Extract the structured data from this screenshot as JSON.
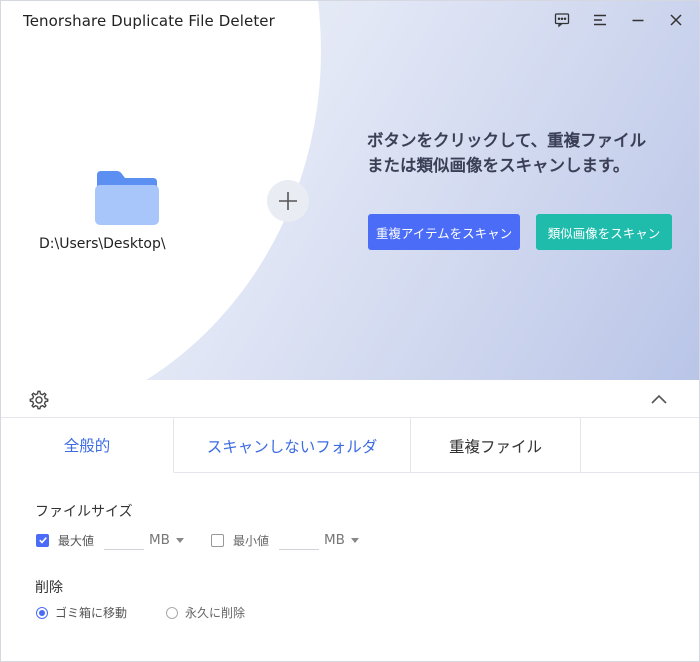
{
  "window": {
    "title": "Tenorshare Duplicate File Deleter",
    "controls": [
      "feedback-icon",
      "menu-icon",
      "minimize-icon",
      "close-icon"
    ]
  },
  "hero": {
    "folder_path": "D:\\Users\\Desktop\\",
    "headline": "ボタンをクリックして、重複ファイルまたは類似画像をスキャンします。",
    "scan_duplicates_label": "重複アイテムをスキャン",
    "scan_similar_label": "類似画像をスキャン",
    "colors": {
      "primary": "#4a6cf7",
      "teal": "#1fbcab",
      "folder": "#7aa3f5"
    }
  },
  "settings": {
    "tabs": [
      {
        "label": "全般的",
        "active": true
      },
      {
        "label": "スキャンしないフォルダ",
        "active": false
      },
      {
        "label": "重複ファイル",
        "active": false
      }
    ],
    "file_size": {
      "label": "ファイルサイズ",
      "max": {
        "label": "最大値",
        "checked": true,
        "value": "",
        "unit": "MB"
      },
      "min": {
        "label": "最小値",
        "checked": false,
        "value": "",
        "unit": "MB"
      }
    },
    "delete": {
      "label": "削除",
      "options": [
        {
          "label": "ゴミ箱に移動",
          "selected": true
        },
        {
          "label": "永久に削除",
          "selected": false
        }
      ]
    }
  }
}
